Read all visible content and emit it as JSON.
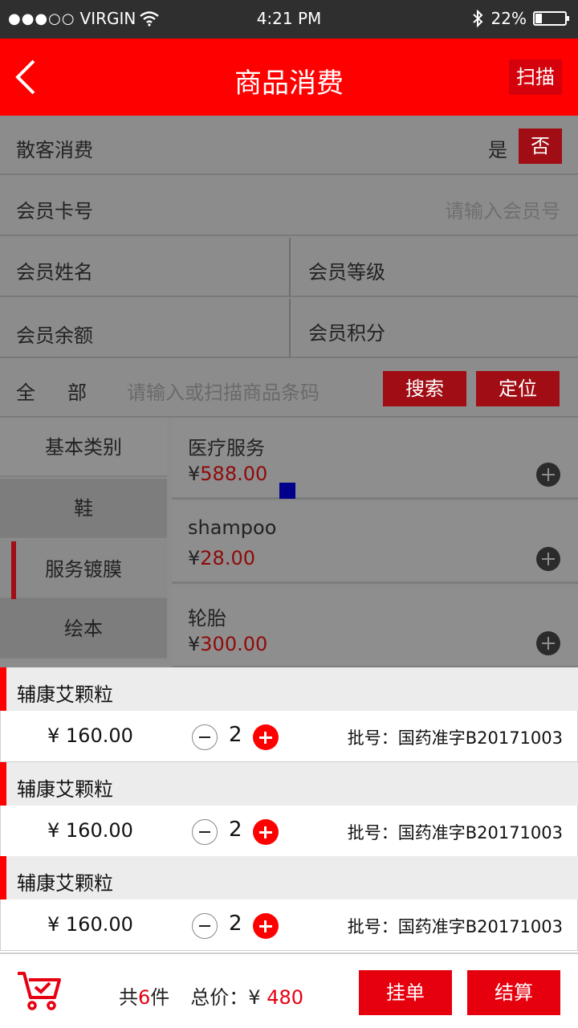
{
  "status_bar": {
    "signal": "●●●○○",
    "carrier": "VIRGIN",
    "time": "4:21 PM",
    "battery_text": "22%",
    "battery_level": 0.22
  },
  "nav": {
    "title": "商品消费",
    "scan_label": "扫描"
  },
  "form": {
    "walkin_label": "散客消费",
    "yes_label": "是",
    "no_label": "否",
    "card_label": "会员卡号",
    "card_placeholder": "请输入会员号",
    "name_label": "会员姓名",
    "level_label": "会员等级",
    "balance_label": "会员余额",
    "points_label": "会员积分"
  },
  "search": {
    "all_label": "全部",
    "placeholder": "请输入或扫描商品条码",
    "search_label": "搜索",
    "locate_label": "定位"
  },
  "categories": [
    "基本类别",
    "鞋",
    "服务镀膜",
    "绘本"
  ],
  "products": [
    {
      "name": "医疗服务",
      "currency": "¥",
      "price": "588.00"
    },
    {
      "name": "shampoo",
      "currency": "¥",
      "price": "28.00"
    },
    {
      "name": "轮胎",
      "currency": "¥",
      "price": "300.00"
    }
  ],
  "cart": [
    {
      "name": "辅康艾颗粒",
      "price": "¥ 160.00",
      "qty": "2",
      "batch": "批号：国药准字B20171003"
    },
    {
      "name": "辅康艾颗粒",
      "price": "¥ 160.00",
      "qty": "2",
      "batch": "批号：国药准字B20171003"
    },
    {
      "name": "辅康艾颗粒",
      "price": "¥ 160.00",
      "qty": "2",
      "batch": "批号：国药准字B20171003"
    }
  ],
  "footer": {
    "count_prefix": "共",
    "count": "6",
    "count_suffix": "件",
    "total_label": "总价：",
    "currency": "¥ ",
    "total": "480",
    "hold_label": "挂单",
    "checkout_label": "结算"
  },
  "colors": {
    "accent": "#ff0000",
    "dark_red": "#a00d14",
    "button_red": "#e6000e"
  }
}
